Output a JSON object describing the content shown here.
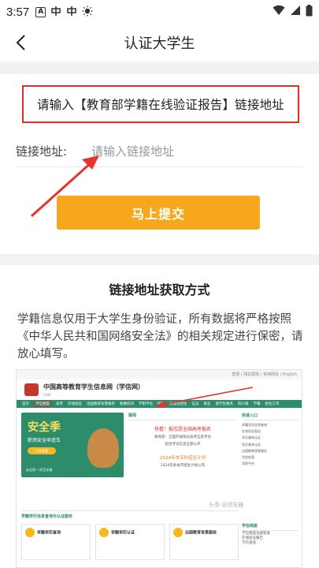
{
  "status_bar": {
    "time": "3:57",
    "icons": [
      "notification-a-icon",
      "app-icon",
      "app-icon",
      "brightness-icon"
    ],
    "right_icons": [
      "wifi-icon",
      "signal-icon",
      "battery-icon"
    ]
  },
  "nav": {
    "title": "认证大学生"
  },
  "form": {
    "instruction": "请输入【教育部学籍在线验证报告】链接地址",
    "link_label": "链接地址:",
    "link_placeholder": "请输入链接地址",
    "submit_label": "马上提交"
  },
  "howto": {
    "title": "链接地址获取方式",
    "description": "学籍信息仅用于大学生身份验证，所有数据将严格按照《中华人民共和国网络安全法》的相关规定进行保密，请放心填写。"
  },
  "screenshot": {
    "topbar_links": "登录 | 网站帮助 | 常用网址 | English",
    "site_name": "中国高等教育学生信息网（学信网）",
    "site_sub": "CHSI",
    "nav_items": [
      "首页",
      "学信档案",
      "高考",
      "在线验证",
      "出国教育背景服务",
      "图像校对",
      "学职平台",
      "研招",
      "港澳台招生",
      "征兵",
      "就业",
      "留学生服务",
      "四六级",
      "学籍",
      "招生工作"
    ],
    "nav_circled_item": "学信档案",
    "banner_big": "安全季",
    "banner_line": "职场安全早班车",
    "banner_button": "点击查看",
    "banner_foot": "安全第一·防范诈骗",
    "news_header": "要闻",
    "news_headline": "快看！报志愿全国高考报名",
    "news_line1": "教育部：全面开放阳光高考信息平台",
    "news_line2": "招生考试信息全部公开",
    "news_highlight": "2024年本专科招生计划",
    "news_line3": "2024年各省市招生计划公布",
    "side_header": "快速入口",
    "side_items": [
      "学籍学历信息查询",
      "在线验证报告",
      "学历查询认证",
      "学位查询认证",
      "出国教育背景服务",
      "学信档案",
      "学职平台"
    ],
    "services_header": "学籍学历信息查询与认证服务",
    "service_boxes": [
      "学籍学历查询",
      "学籍学历认证",
      "出国教育背景服务"
    ],
    "help_header": "学信档案",
    "help_lines": [
      "学信档案注册登录",
      "在线验证报告",
      "学历查询"
    ],
    "watermark": "头条 @浏览器"
  }
}
